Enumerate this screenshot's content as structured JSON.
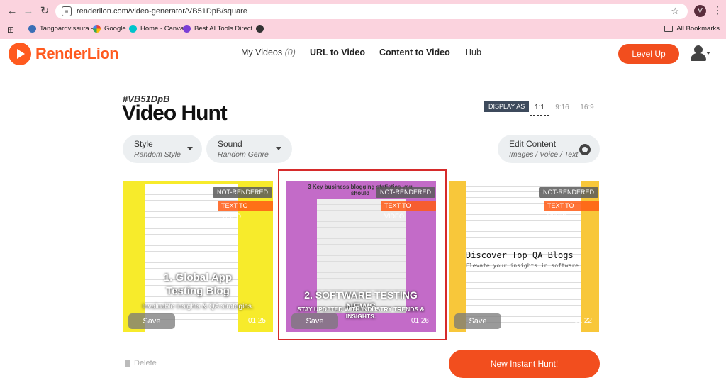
{
  "browser": {
    "url": "renderlion.com/video-generator/VB51DpB/square",
    "profile_initial": "V",
    "bookmarks": [
      "Tangoardvissura -",
      "Google",
      "Home - Canva",
      "Best AI Tools Direct..."
    ],
    "all_bookmarks": "All Bookmarks"
  },
  "app": {
    "brand": "RenderLion",
    "nav": {
      "my_videos": "My Videos",
      "my_videos_count": "(0)",
      "url_to_video": "URL to Video",
      "content_to_video": "Content to Video",
      "hub": "Hub"
    },
    "level_up": "Level Up"
  },
  "hunt": {
    "id": "#VB51DpB",
    "title": "Video Hunt",
    "display_as": "DISPLAY AS",
    "ratios": [
      "1:1",
      "9:16",
      "16:9"
    ],
    "style_label": "Style",
    "style_value": "Random Style",
    "sound_label": "Sound",
    "sound_value": "Random Genre",
    "edit_label": "Edit Content",
    "edit_value": "Images / Voice / Text"
  },
  "cards": [
    {
      "badge": "NOT-RENDERED",
      "action": "TEXT TO VIDEO",
      "save": "Save",
      "duration": "01:25",
      "overlay1": "1. Global App",
      "overlay2": "Testing Blog",
      "overlay3": "Invaluable insights & QA strategies."
    },
    {
      "badge": "NOT-RENDERED",
      "action": "TEXT TO VIDEO",
      "save": "Save",
      "duration": "01:26",
      "overlay1": "2. SOFTWARE TESTING NEWS",
      "overlay2": "STAY UPDATED WITH INDUSTRY TRENDS & INSIGHTS.",
      "doc_title": "3 Key business blogging statistics you should"
    },
    {
      "badge": "NOT-RENDERED",
      "action": "TEXT TO VIDEO",
      "save": "Save",
      "duration": "01:22",
      "overlay1": "Discover Top QA Blogs",
      "overlay2": "Elevate your insights in software"
    }
  ],
  "footer": {
    "delete": "Delete",
    "new_hunt": "New Instant Hunt!"
  }
}
